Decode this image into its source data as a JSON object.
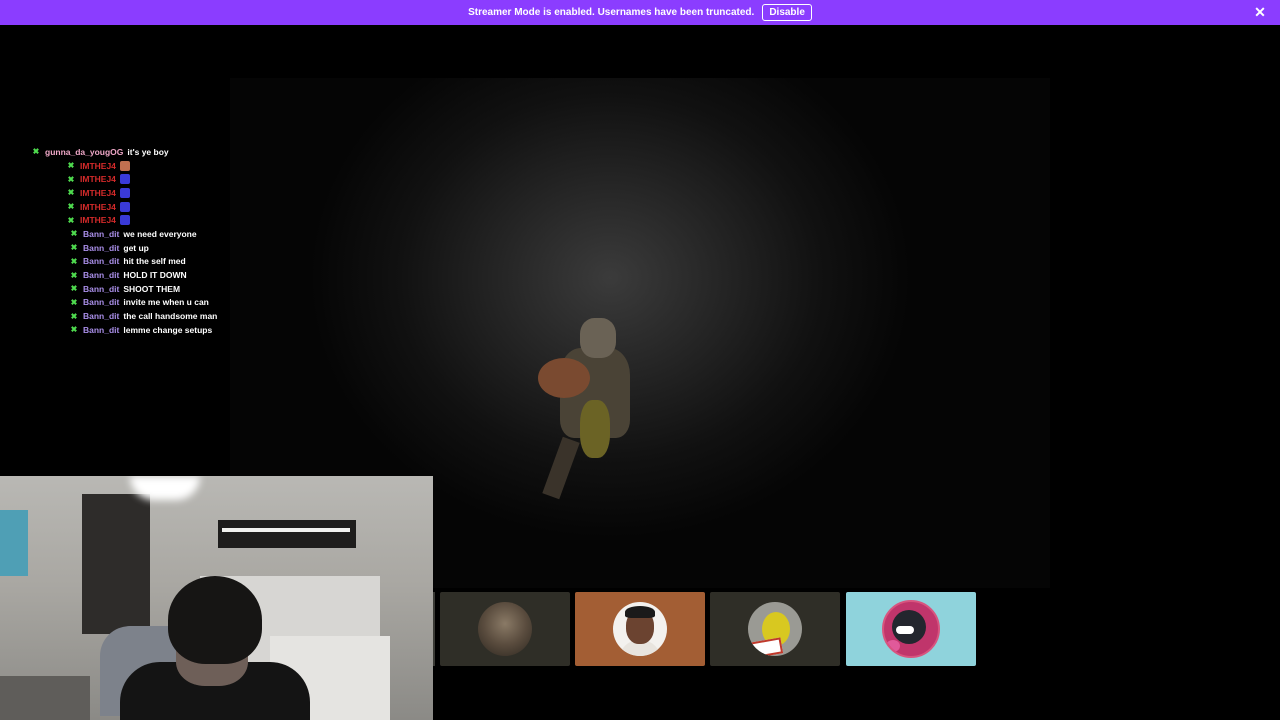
{
  "banner": {
    "text": "Streamer Mode is enabled. Usernames have been truncated.",
    "disable_label": "Disable",
    "close_icon": "close-icon",
    "background": "#8b3dff"
  },
  "chat": {
    "messages": [
      {
        "user": "gunna_da_yougOG",
        "text": "it's ye boy",
        "user_color": "#f0a8c8",
        "emote": null
      },
      {
        "user": "IMTHEJ4",
        "text": "",
        "user_color": "#d42a2a",
        "emote": "#c07050"
      },
      {
        "user": "IMTHEJ4",
        "text": "",
        "user_color": "#d42a2a",
        "emote": "#3a3ad8"
      },
      {
        "user": "IMTHEJ4",
        "text": "",
        "user_color": "#d42a2a",
        "emote": "#3a3ad8"
      },
      {
        "user": "IMTHEJ4",
        "text": "",
        "user_color": "#d42a2a",
        "emote": "#3a3ad8"
      },
      {
        "user": "IMTHEJ4",
        "text": "",
        "user_color": "#d42a2a",
        "emote": "#3a3ad8"
      },
      {
        "user": "Bann_dit",
        "text": "we need everyone",
        "user_color": "#a98ee8",
        "emote": null
      },
      {
        "user": "Bann_dit",
        "text": "get up",
        "user_color": "#a98ee8",
        "emote": null
      },
      {
        "user": "Bann_dit",
        "text": "hit the self med",
        "user_color": "#a98ee8",
        "emote": null
      },
      {
        "user": "Bann_dit",
        "text": "HOLD IT DOWN",
        "user_color": "#a98ee8",
        "emote": null
      },
      {
        "user": "Bann_dit",
        "text": "SHOOT THEM",
        "user_color": "#a98ee8",
        "emote": null
      },
      {
        "user": "Bann_dit",
        "text": "invite me when u can",
        "user_color": "#a98ee8",
        "emote": null
      },
      {
        "user": "Bann_dit",
        "text": "the call handsome man",
        "user_color": "#a98ee8",
        "emote": null
      },
      {
        "user": "Bann_dit",
        "text": "lemme change setups",
        "user_color": "#a98ee8",
        "emote": null
      }
    ],
    "badge_icon": "sword-badge-icon",
    "badge_color": "#4fdc4f"
  },
  "participants": [
    {
      "name": "participant-1",
      "tile_color": "#2f2e27"
    },
    {
      "name": "participant-2",
      "tile_color": "#a35e34"
    },
    {
      "name": "participant-3",
      "tile_color": "#2f2e27"
    },
    {
      "name": "participant-4",
      "tile_color": "#8fd3dc"
    }
  ]
}
